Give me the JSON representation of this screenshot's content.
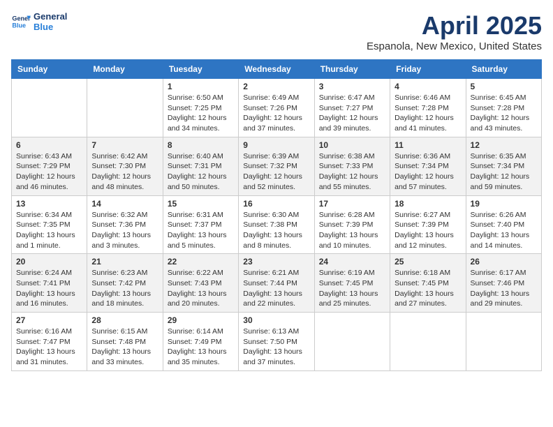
{
  "header": {
    "logo_line1": "General",
    "logo_line2": "Blue",
    "title": "April 2025",
    "subtitle": "Espanola, New Mexico, United States"
  },
  "weekdays": [
    "Sunday",
    "Monday",
    "Tuesday",
    "Wednesday",
    "Thursday",
    "Friday",
    "Saturday"
  ],
  "weeks": [
    [
      {
        "day": "",
        "sunrise": "",
        "sunset": "",
        "daylight": ""
      },
      {
        "day": "",
        "sunrise": "",
        "sunset": "",
        "daylight": ""
      },
      {
        "day": "1",
        "sunrise": "Sunrise: 6:50 AM",
        "sunset": "Sunset: 7:25 PM",
        "daylight": "Daylight: 12 hours and 34 minutes."
      },
      {
        "day": "2",
        "sunrise": "Sunrise: 6:49 AM",
        "sunset": "Sunset: 7:26 PM",
        "daylight": "Daylight: 12 hours and 37 minutes."
      },
      {
        "day": "3",
        "sunrise": "Sunrise: 6:47 AM",
        "sunset": "Sunset: 7:27 PM",
        "daylight": "Daylight: 12 hours and 39 minutes."
      },
      {
        "day": "4",
        "sunrise": "Sunrise: 6:46 AM",
        "sunset": "Sunset: 7:28 PM",
        "daylight": "Daylight: 12 hours and 41 minutes."
      },
      {
        "day": "5",
        "sunrise": "Sunrise: 6:45 AM",
        "sunset": "Sunset: 7:28 PM",
        "daylight": "Daylight: 12 hours and 43 minutes."
      }
    ],
    [
      {
        "day": "6",
        "sunrise": "Sunrise: 6:43 AM",
        "sunset": "Sunset: 7:29 PM",
        "daylight": "Daylight: 12 hours and 46 minutes."
      },
      {
        "day": "7",
        "sunrise": "Sunrise: 6:42 AM",
        "sunset": "Sunset: 7:30 PM",
        "daylight": "Daylight: 12 hours and 48 minutes."
      },
      {
        "day": "8",
        "sunrise": "Sunrise: 6:40 AM",
        "sunset": "Sunset: 7:31 PM",
        "daylight": "Daylight: 12 hours and 50 minutes."
      },
      {
        "day": "9",
        "sunrise": "Sunrise: 6:39 AM",
        "sunset": "Sunset: 7:32 PM",
        "daylight": "Daylight: 12 hours and 52 minutes."
      },
      {
        "day": "10",
        "sunrise": "Sunrise: 6:38 AM",
        "sunset": "Sunset: 7:33 PM",
        "daylight": "Daylight: 12 hours and 55 minutes."
      },
      {
        "day": "11",
        "sunrise": "Sunrise: 6:36 AM",
        "sunset": "Sunset: 7:34 PM",
        "daylight": "Daylight: 12 hours and 57 minutes."
      },
      {
        "day": "12",
        "sunrise": "Sunrise: 6:35 AM",
        "sunset": "Sunset: 7:34 PM",
        "daylight": "Daylight: 12 hours and 59 minutes."
      }
    ],
    [
      {
        "day": "13",
        "sunrise": "Sunrise: 6:34 AM",
        "sunset": "Sunset: 7:35 PM",
        "daylight": "Daylight: 13 hours and 1 minute."
      },
      {
        "day": "14",
        "sunrise": "Sunrise: 6:32 AM",
        "sunset": "Sunset: 7:36 PM",
        "daylight": "Daylight: 13 hours and 3 minutes."
      },
      {
        "day": "15",
        "sunrise": "Sunrise: 6:31 AM",
        "sunset": "Sunset: 7:37 PM",
        "daylight": "Daylight: 13 hours and 5 minutes."
      },
      {
        "day": "16",
        "sunrise": "Sunrise: 6:30 AM",
        "sunset": "Sunset: 7:38 PM",
        "daylight": "Daylight: 13 hours and 8 minutes."
      },
      {
        "day": "17",
        "sunrise": "Sunrise: 6:28 AM",
        "sunset": "Sunset: 7:39 PM",
        "daylight": "Daylight: 13 hours and 10 minutes."
      },
      {
        "day": "18",
        "sunrise": "Sunrise: 6:27 AM",
        "sunset": "Sunset: 7:39 PM",
        "daylight": "Daylight: 13 hours and 12 minutes."
      },
      {
        "day": "19",
        "sunrise": "Sunrise: 6:26 AM",
        "sunset": "Sunset: 7:40 PM",
        "daylight": "Daylight: 13 hours and 14 minutes."
      }
    ],
    [
      {
        "day": "20",
        "sunrise": "Sunrise: 6:24 AM",
        "sunset": "Sunset: 7:41 PM",
        "daylight": "Daylight: 13 hours and 16 minutes."
      },
      {
        "day": "21",
        "sunrise": "Sunrise: 6:23 AM",
        "sunset": "Sunset: 7:42 PM",
        "daylight": "Daylight: 13 hours and 18 minutes."
      },
      {
        "day": "22",
        "sunrise": "Sunrise: 6:22 AM",
        "sunset": "Sunset: 7:43 PM",
        "daylight": "Daylight: 13 hours and 20 minutes."
      },
      {
        "day": "23",
        "sunrise": "Sunrise: 6:21 AM",
        "sunset": "Sunset: 7:44 PM",
        "daylight": "Daylight: 13 hours and 22 minutes."
      },
      {
        "day": "24",
        "sunrise": "Sunrise: 6:19 AM",
        "sunset": "Sunset: 7:45 PM",
        "daylight": "Daylight: 13 hours and 25 minutes."
      },
      {
        "day": "25",
        "sunrise": "Sunrise: 6:18 AM",
        "sunset": "Sunset: 7:45 PM",
        "daylight": "Daylight: 13 hours and 27 minutes."
      },
      {
        "day": "26",
        "sunrise": "Sunrise: 6:17 AM",
        "sunset": "Sunset: 7:46 PM",
        "daylight": "Daylight: 13 hours and 29 minutes."
      }
    ],
    [
      {
        "day": "27",
        "sunrise": "Sunrise: 6:16 AM",
        "sunset": "Sunset: 7:47 PM",
        "daylight": "Daylight: 13 hours and 31 minutes."
      },
      {
        "day": "28",
        "sunrise": "Sunrise: 6:15 AM",
        "sunset": "Sunset: 7:48 PM",
        "daylight": "Daylight: 13 hours and 33 minutes."
      },
      {
        "day": "29",
        "sunrise": "Sunrise: 6:14 AM",
        "sunset": "Sunset: 7:49 PM",
        "daylight": "Daylight: 13 hours and 35 minutes."
      },
      {
        "day": "30",
        "sunrise": "Sunrise: 6:13 AM",
        "sunset": "Sunset: 7:50 PM",
        "daylight": "Daylight: 13 hours and 37 minutes."
      },
      {
        "day": "",
        "sunrise": "",
        "sunset": "",
        "daylight": ""
      },
      {
        "day": "",
        "sunrise": "",
        "sunset": "",
        "daylight": ""
      },
      {
        "day": "",
        "sunrise": "",
        "sunset": "",
        "daylight": ""
      }
    ]
  ]
}
